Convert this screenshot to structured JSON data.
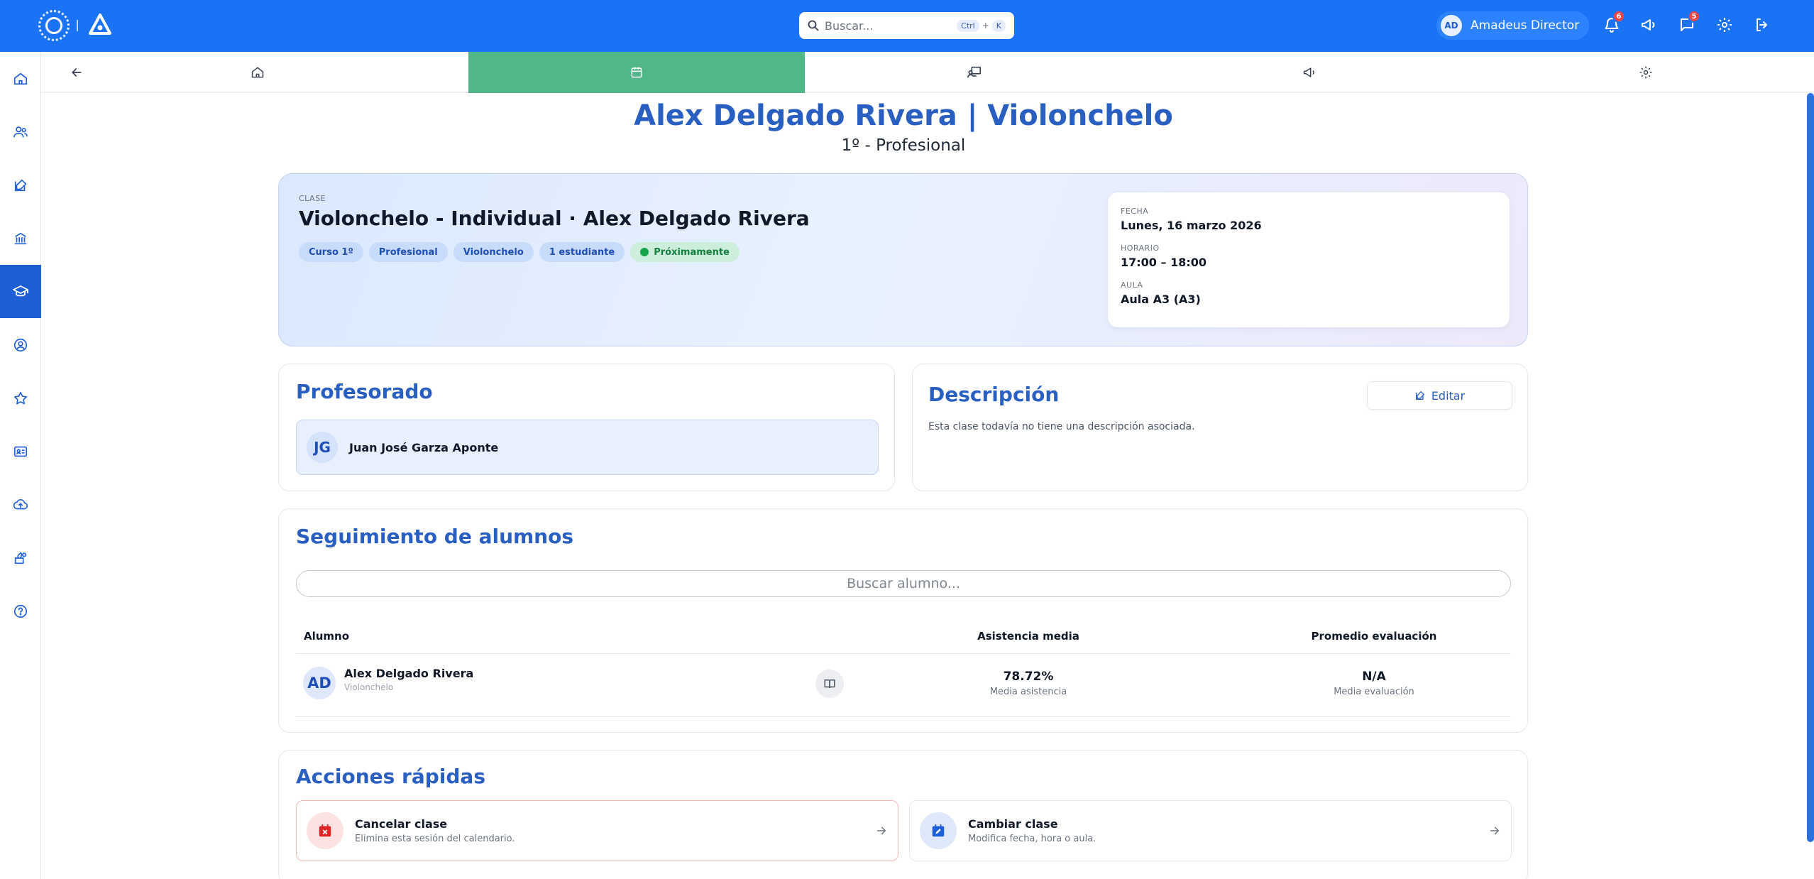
{
  "topbar": {
    "search_placeholder": "Buscar...",
    "shortcut_key1": "Ctrl",
    "shortcut_plus": "+",
    "shortcut_key2": "K",
    "user_initials": "AD",
    "user_name": "Amadeus Director",
    "notifications_count": "6",
    "messages_count": "5",
    "colors": {
      "bar": "#1a73f5"
    }
  },
  "sidebar": {
    "items": [
      {
        "icon": "home-icon"
      },
      {
        "icon": "users-icon"
      },
      {
        "icon": "edit-icon"
      },
      {
        "icon": "building-icon"
      },
      {
        "icon": "graduation-cap-icon",
        "active": true
      },
      {
        "icon": "user-circle-icon"
      },
      {
        "icon": "star-icon"
      },
      {
        "icon": "id-card-icon"
      },
      {
        "icon": "cloud-upload-icon"
      },
      {
        "icon": "payments-icon"
      },
      {
        "icon": "help-icon"
      }
    ],
    "active_color": "#1e5fd6"
  },
  "tabs": {
    "items": [
      {
        "icon": "back-arrow-icon"
      },
      {
        "icon": "home-icon"
      },
      {
        "icon": "calendar-icon",
        "active": true
      },
      {
        "icon": "teacher-board-icon"
      },
      {
        "icon": "megaphone-icon"
      },
      {
        "icon": "gear-icon"
      }
    ],
    "active_color": "#52b788"
  },
  "header": {
    "title": "Alex Delgado Rivera | Violonchelo",
    "subtitle": "1º - Profesional"
  },
  "class_card": {
    "kicker": "CLASE",
    "title": "Violonchelo - Individual · Alex Delgado Rivera",
    "chips": [
      "Curso 1º",
      "Profesional",
      "Violonchelo",
      "1 estudiante"
    ],
    "status_chip": "Próximamente",
    "date_label": "FECHA",
    "date_value": "Lunes, 16 marzo 2026",
    "time_label": "HORARIO",
    "time_value": "17:00 – 18:00",
    "room_label": "AULA",
    "room_value": "Aula A3 (A3)"
  },
  "teachers": {
    "title": "Profesorado",
    "items": [
      {
        "initials": "JG",
        "name": "Juan José Garza Aponte"
      }
    ]
  },
  "description": {
    "title": "Descripción",
    "edit_label": "Editar",
    "text": "Esta clase todavía no tiene una descripción asociada."
  },
  "students": {
    "title": "Seguimiento de alumnos",
    "search_placeholder": "Buscar alumno...",
    "columns": [
      "Alumno",
      "Asistencia media",
      "Promedio evaluación"
    ],
    "rows": [
      {
        "initials": "AD",
        "name": "Alex Delgado Rivera",
        "instrument": "Violonchelo",
        "attendance": "78.72%",
        "attendance_sub": "Media asistencia",
        "evaluation": "N/A",
        "evaluation_sub": "Media evaluación"
      }
    ]
  },
  "quick_actions": {
    "title": "Acciones rápidas",
    "items": [
      {
        "title": "Cancelar clase",
        "subtitle": "Elimina esta sesión del calendario.",
        "icon": "calendar-x-icon",
        "color": "#dc2626"
      },
      {
        "title": "Cambiar clase",
        "subtitle": "Modifica fecha, hora o aula.",
        "icon": "calendar-edit-icon",
        "color": "#1e5fd6"
      }
    ]
  }
}
